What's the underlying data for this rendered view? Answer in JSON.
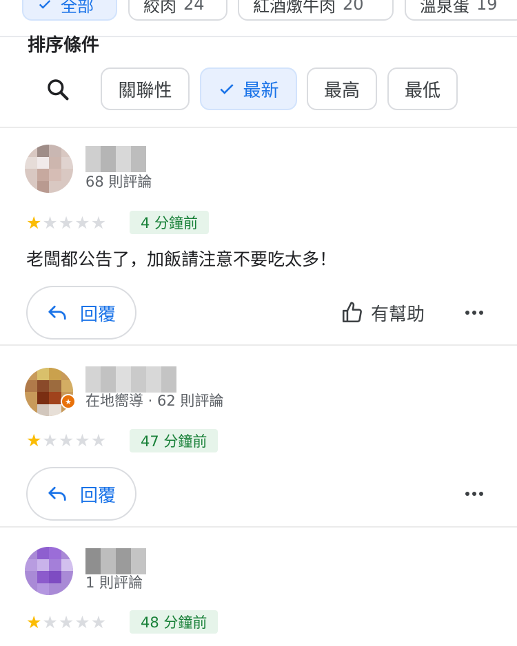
{
  "filter_chips": [
    {
      "label": "全部",
      "count": "",
      "active": true
    },
    {
      "label": "絞肉",
      "count": "24",
      "active": false
    },
    {
      "label": "紅酒燉牛肉",
      "count": "20",
      "active": false
    },
    {
      "label": "溫泉蛋",
      "count": "19",
      "active": false
    }
  ],
  "sort": {
    "title": "排序條件",
    "options": [
      "關聯性",
      "最新",
      "最高",
      "最低"
    ],
    "selected": "最新"
  },
  "reviews": [
    {
      "meta": "68 則評論",
      "rating": 1,
      "time": "4 分鐘前",
      "text": "老闆都公告了，加飯請注意不要吃太多！",
      "reply_label": "回覆",
      "helpful_label": "有幫助"
    },
    {
      "meta": "在地嚮導 · 62 則評論",
      "rating": 1,
      "time": "47 分鐘前",
      "text": "",
      "reply_label": "回覆",
      "helpful_label": ""
    },
    {
      "meta": "1 則評論",
      "rating": 1,
      "time": "48 分鐘前",
      "text": "",
      "reply_label": "",
      "helpful_label": ""
    }
  ],
  "icons": {
    "check": "check-icon",
    "search": "search-icon",
    "reply": "reply-arrow-icon",
    "helpful": "thumbs-up-icon",
    "more": "more-horizontal-icon",
    "local_guide": "local-guide-badge-icon"
  },
  "colors": {
    "accent": "#1a73e8",
    "chip_active_bg": "#e8f0fe",
    "star_on": "#fbbc04",
    "time_badge_bg": "#e6f4ea",
    "time_badge_text": "#188038"
  }
}
